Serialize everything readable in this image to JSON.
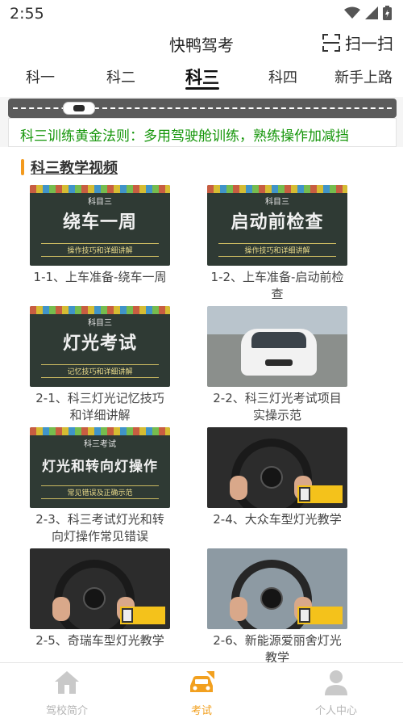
{
  "status": {
    "time": "2:55"
  },
  "header": {
    "title": "快鸭驾考",
    "scan_label": "扫一扫"
  },
  "tabs": [
    {
      "label": "科一",
      "active": false
    },
    {
      "label": "科二",
      "active": false
    },
    {
      "label": "科三",
      "active": true
    },
    {
      "label": "科四",
      "active": false
    },
    {
      "label": "新手上路",
      "active": false
    }
  ],
  "rule_banner": "科三训练黄金法则：多用驾驶舱训练，熟练操作加减挡",
  "section": {
    "title": "科三教学视频"
  },
  "videos": [
    {
      "caption": "1-1、上车准备-绕车一周",
      "thumb": {
        "type": "board",
        "tag": "科目三",
        "big": "绕车一周",
        "sub": "操作技巧和详细讲解"
      }
    },
    {
      "caption": "1-2、上车准备-启动前检查",
      "thumb": {
        "type": "board",
        "tag": "科目三",
        "big": "启动前检查",
        "sub": "操作技巧和详细讲解"
      }
    },
    {
      "caption": "2-1、科三灯光记忆技巧和详细讲解",
      "thumb": {
        "type": "board",
        "tag": "科目三",
        "big": "灯光考试",
        "sub": "记忆技巧和详细讲解"
      }
    },
    {
      "caption": "2-2、科三灯光考试项目实操示范",
      "thumb": {
        "type": "car"
      }
    },
    {
      "caption": "2-3、科三考试灯光和转向灯操作常见错误",
      "thumb": {
        "type": "board",
        "tag": "科三考试",
        "big": "灯光和转向灯操作",
        "sub": "常见错误及正确示范"
      }
    },
    {
      "caption": "2-4、大众车型灯光教学",
      "thumb": {
        "type": "wheel"
      }
    },
    {
      "caption": "2-5、奇瑞车型灯光教学",
      "thumb": {
        "type": "wheel"
      }
    },
    {
      "caption": "2-6、新能源爱丽舍灯光教学",
      "thumb": {
        "type": "wheel"
      }
    }
  ],
  "bottom_nav": [
    {
      "label": "驾校简介",
      "icon": "house-icon",
      "active": false
    },
    {
      "label": "考试",
      "icon": "car-exam-icon",
      "active": true
    },
    {
      "label": "个人中心",
      "icon": "person-icon",
      "active": false
    }
  ],
  "colors": {
    "accent": "#f2a01f",
    "rule_text": "#15960a",
    "section_bar": "#f39a1e"
  }
}
